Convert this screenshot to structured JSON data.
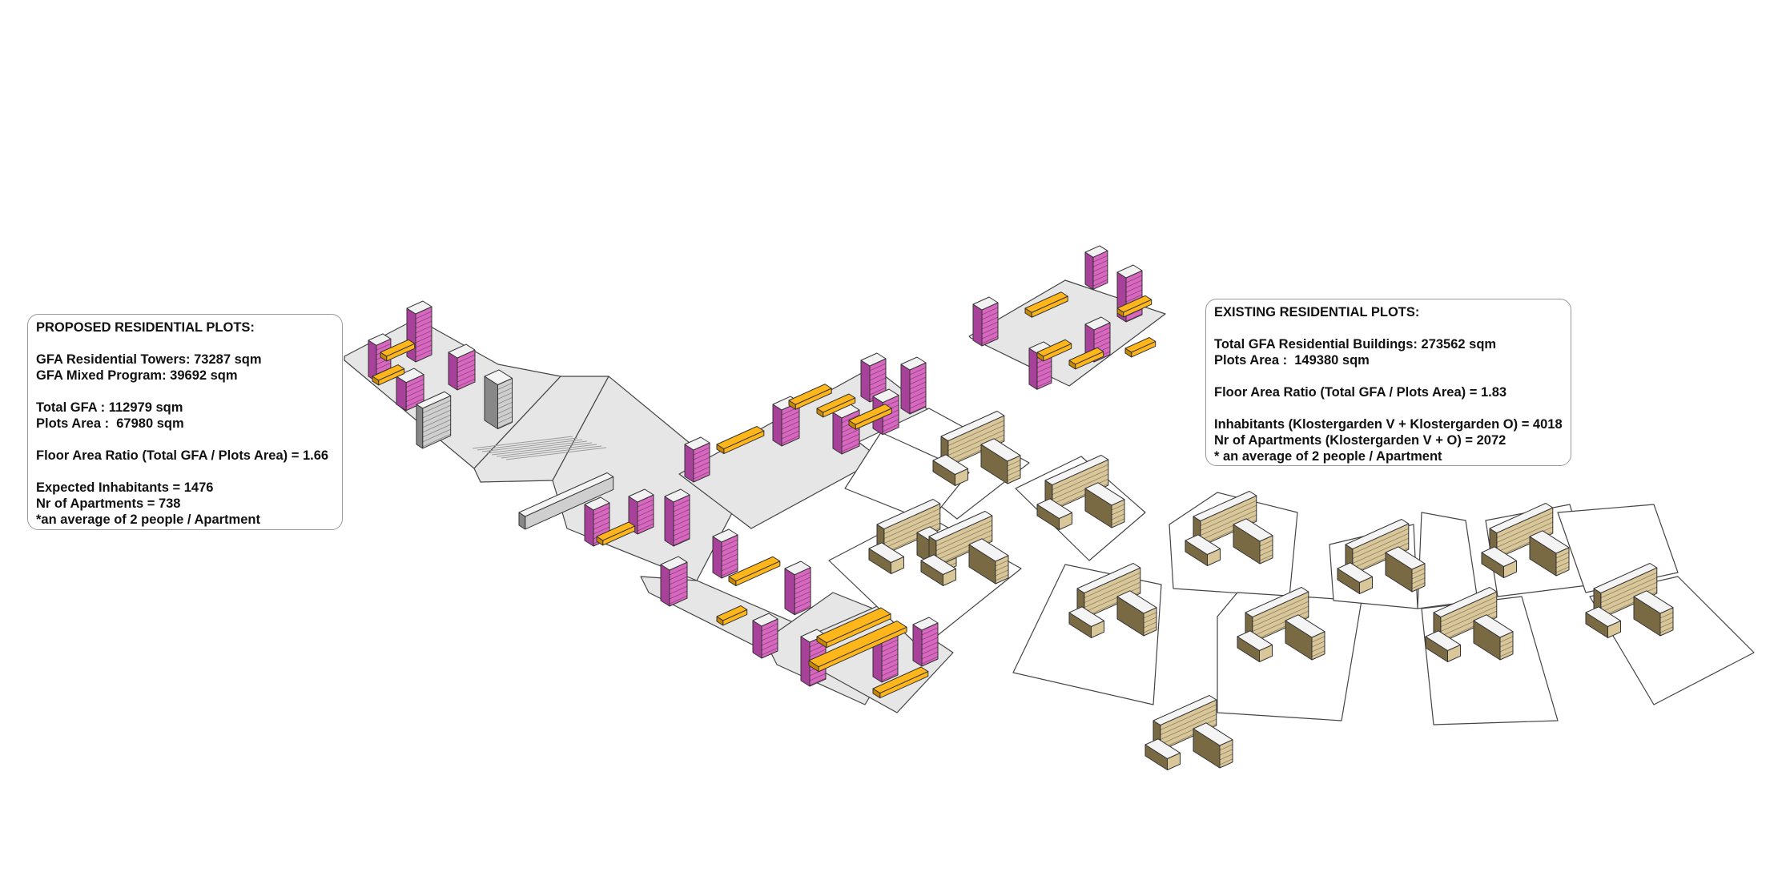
{
  "colors": {
    "plot_fill": "#e6e6e6",
    "plot_stroke": "#444444",
    "tower_pink": "#d867c0",
    "tower_pink_dark": "#a8419a",
    "mixed_orange": "#ffb61a",
    "mixed_orange_dark": "#c98700",
    "existing_tan": "#d9c79a",
    "existing_tan_dark": "#7a6a44",
    "box_border": "#9a9a9a"
  },
  "legend_boxes": {
    "proposed": {
      "lines": [
        "PROPOSED RESIDENTIAL PLOTS:",
        "",
        "GFA Residential Towers: 73287 sqm",
        "GFA Mixed Program: 39692 sqm",
        "",
        "Total GFA : 112979 sqm",
        "Plots Area :  67980 sqm",
        "",
        "Floor Area Ratio (Total GFA / Plots Area) = 1.66",
        "",
        "Expected Inhabitants = 1476",
        "Nr of Apartments = 738",
        "*an average of 2 people / Apartment"
      ]
    },
    "existing": {
      "lines": [
        "EXISTING RESIDENTIAL PLOTS:",
        "",
        "Total GFA Residential Buildings: 273562 sqm",
        "Plots Area :  149380 sqm",
        "",
        "Floor Area Ratio (Total GFA / Plots Area) = 1.83",
        "",
        "Inhabitants (Klostergarden V + Klostergarden O) = 4018",
        "Nr of Apartments (Klostergarden V + O) = 2072",
        "* an average of 2 people / Apartment"
      ]
    }
  }
}
